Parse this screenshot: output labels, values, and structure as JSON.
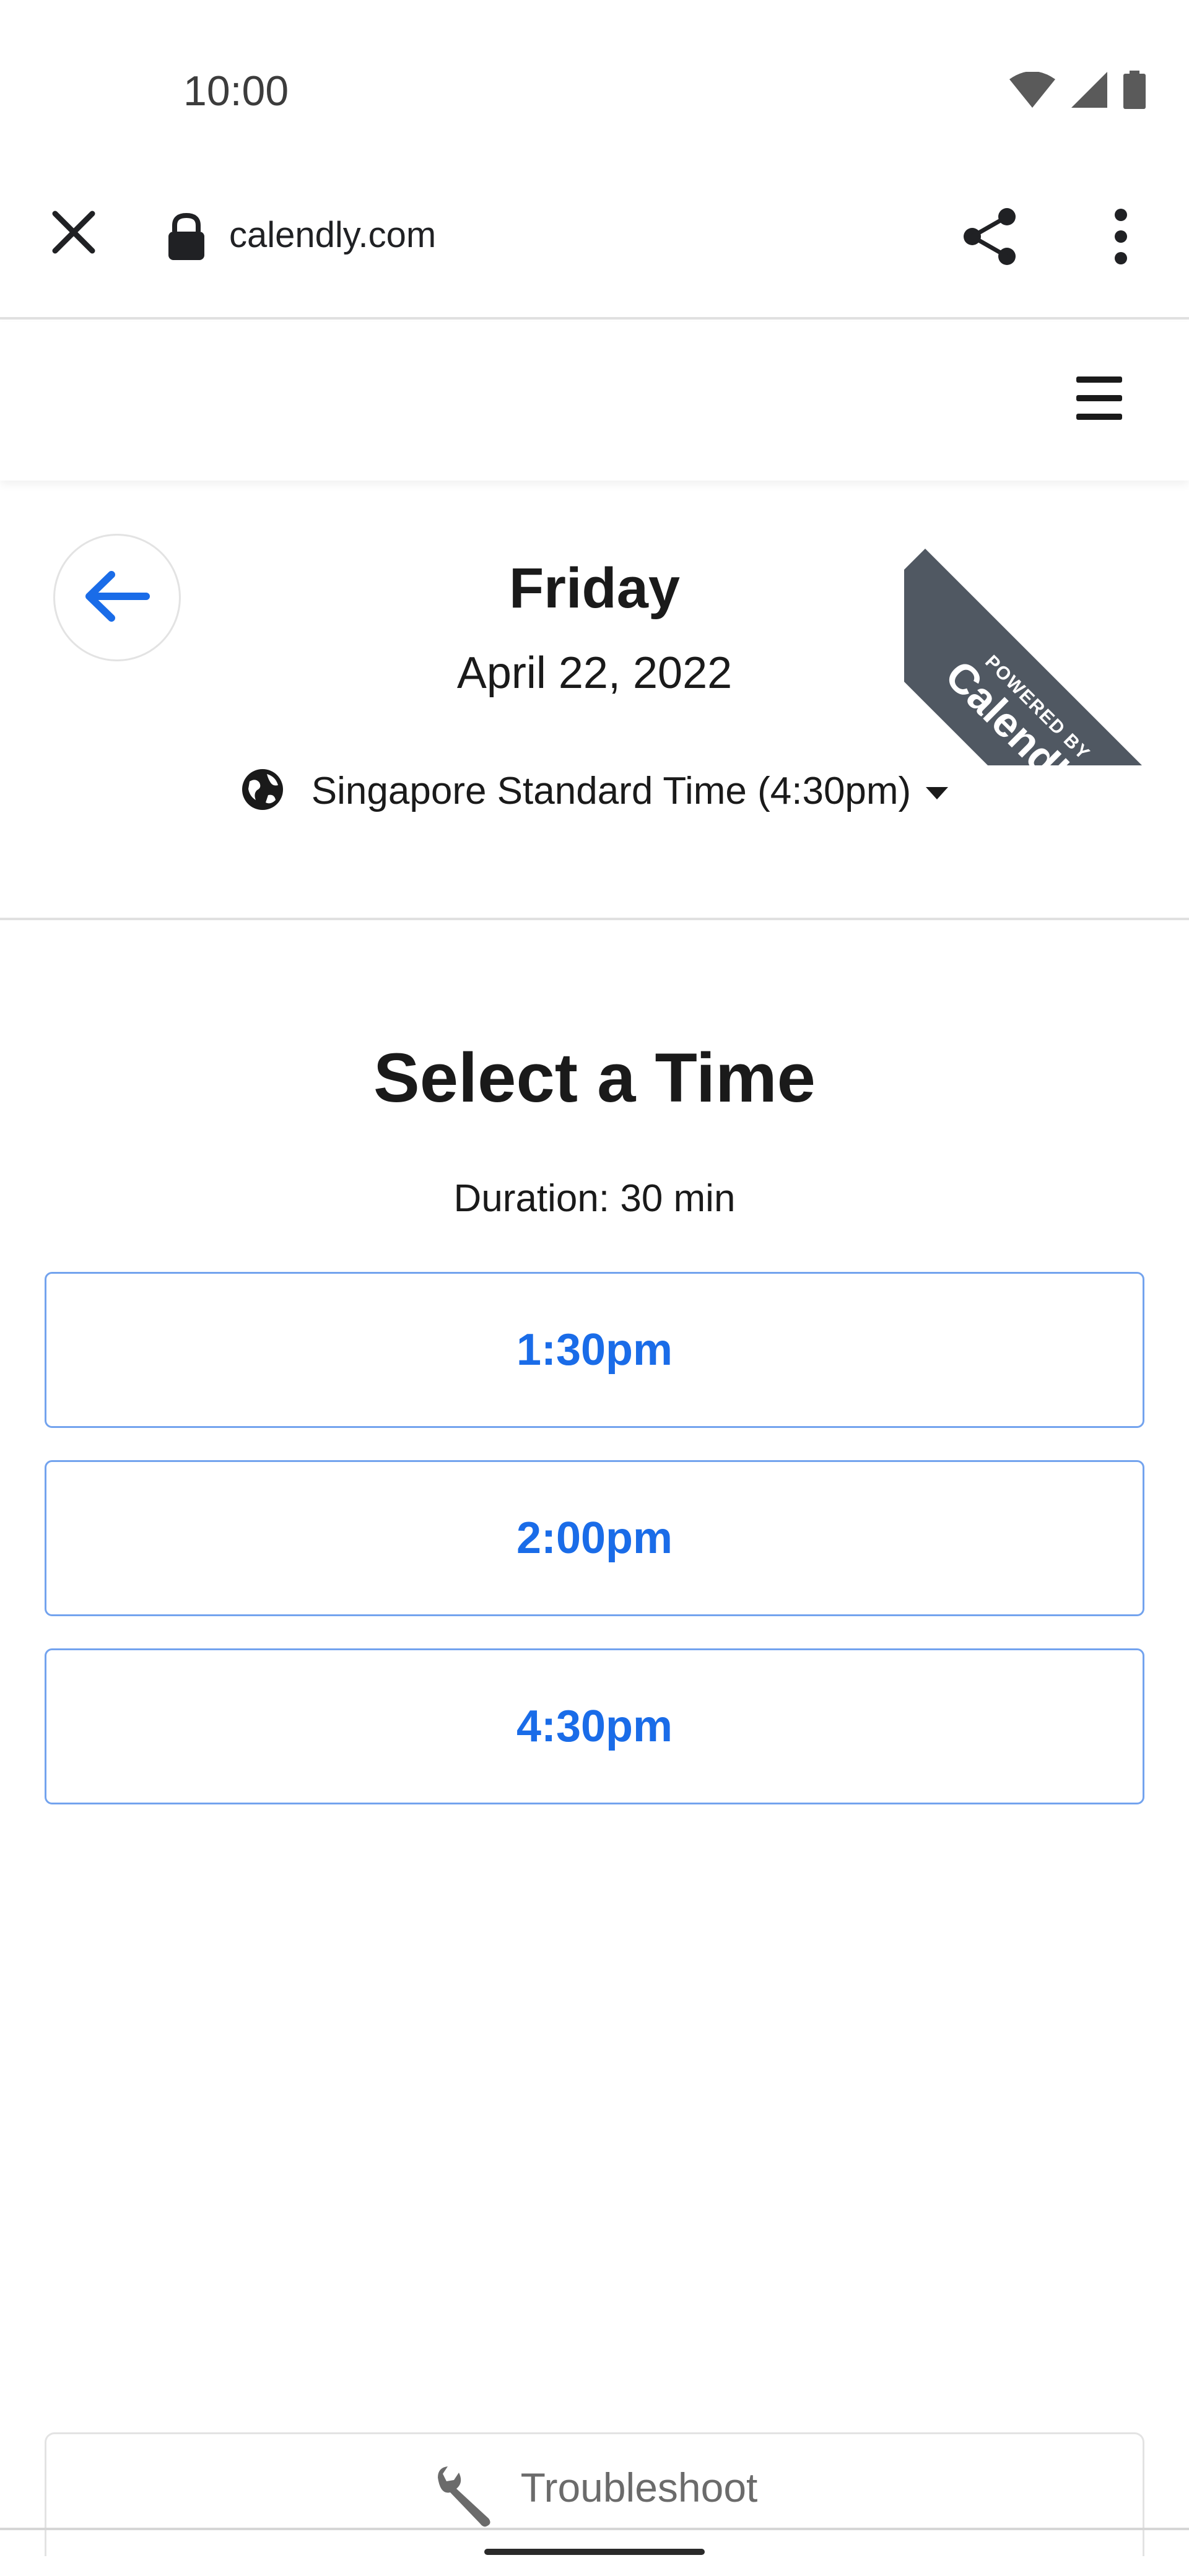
{
  "status_bar": {
    "time": "10:00",
    "icons": [
      "wifi-icon",
      "cell-signal-icon",
      "battery-icon"
    ]
  },
  "browser": {
    "url": "calendly.com",
    "icons": [
      "close-icon",
      "lock-icon",
      "share-icon",
      "more-vert-icon"
    ]
  },
  "header": {
    "menu_icon": "hamburger-menu-icon"
  },
  "date_section": {
    "back_icon": "arrow-left-icon",
    "day": "Friday",
    "date": "April 22, 2022",
    "timezone": "Singapore Standard Time (4:30pm)",
    "globe_icon": "globe-icon"
  },
  "badge": {
    "top": "POWERED BY",
    "brand": "Calendly"
  },
  "time_selection": {
    "title": "Select a Time",
    "duration": "Duration: 30 min",
    "slots": [
      "1:30pm",
      "2:00pm",
      "4:30pm"
    ]
  },
  "footer": {
    "troubleshoot_label": "Troubleshoot",
    "wrench_icon": "wrench-icon"
  },
  "colors": {
    "accent": "#1a6ce8",
    "slot_border": "#73a3ee",
    "ribbon": "#505862"
  }
}
